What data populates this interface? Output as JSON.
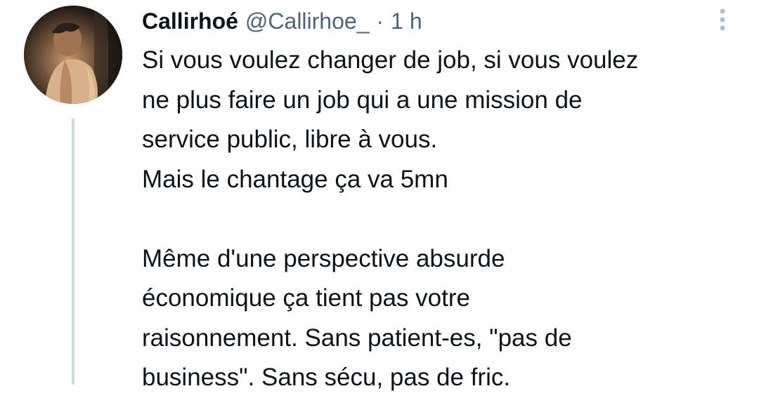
{
  "tweet": {
    "author": {
      "display_name": "Callirhoé",
      "handle": "@Callirhoe_",
      "avatar_icon": "profile-photo"
    },
    "separator": "·",
    "timestamp": "1 h",
    "more_icon": "vertical-ellipsis-icon",
    "text_lines": [
      "Si vous voulez changer de job, si vous voulez",
      "ne plus faire un job qui a une mission de",
      "service public, libre à vous.",
      "Mais le chantage ça va 5mn",
      "",
      "Même d'une perspective absurde",
      "économique ça tient pas votre",
      "raisonnement. Sans patient-es, \"pas de",
      "business\". Sans sécu, pas de fric."
    ]
  },
  "colors": {
    "text_primary": "#0f1419",
    "text_secondary": "#536471",
    "thread_line": "#cfd9de",
    "background": "#ffffff"
  }
}
